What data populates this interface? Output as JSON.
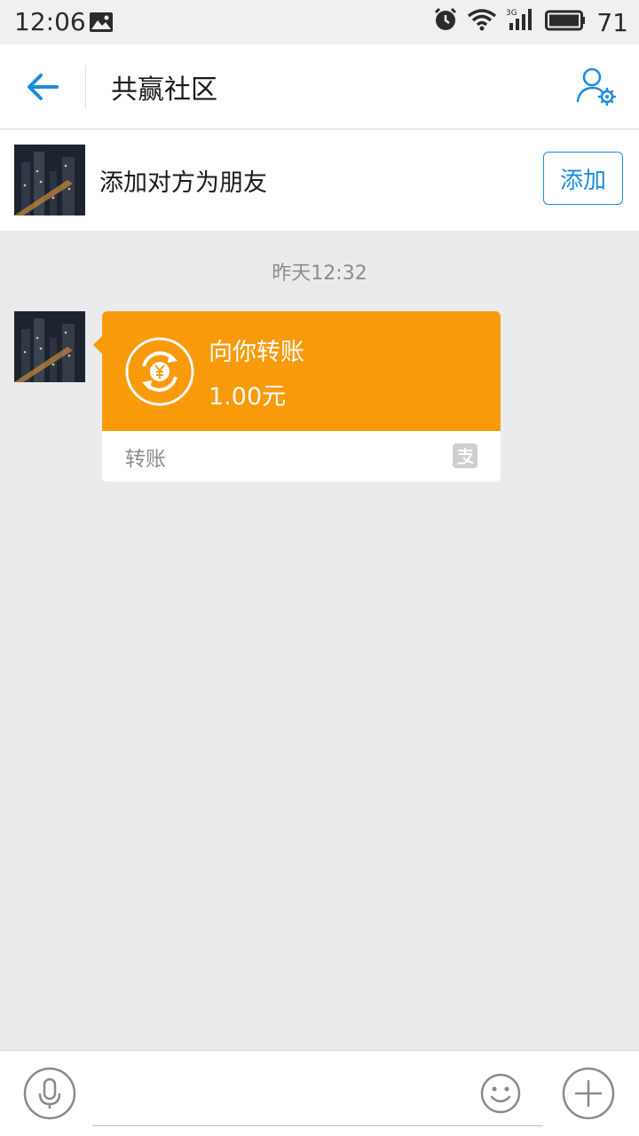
{
  "status_bar": {
    "time": "12:06",
    "network": "3G",
    "battery": "71",
    "icons": [
      "image-icon",
      "alarm-icon",
      "wifi-icon",
      "signal-3g-icon",
      "battery-icon"
    ]
  },
  "header": {
    "title": "共赢社区",
    "back_icon": "back-arrow-icon",
    "profile_icon": "profile-settings-icon"
  },
  "friend_bar": {
    "text": "添加对方为朋友",
    "add_label": "添加"
  },
  "chat": {
    "timestamp": "昨天12:32",
    "message": {
      "title": "向你转账",
      "amount": "1.00元",
      "footer_label": "转账",
      "icon": "transfer-yuan-icon",
      "brand_icon": "alipay-icon"
    }
  },
  "input_bar": {
    "placeholder": "",
    "icons": [
      "microphone-icon",
      "emoji-icon",
      "plus-icon"
    ]
  },
  "colors": {
    "accent": "#1b8be0",
    "transfer_orange": "#f99a0b",
    "background": "#ebebeb"
  }
}
